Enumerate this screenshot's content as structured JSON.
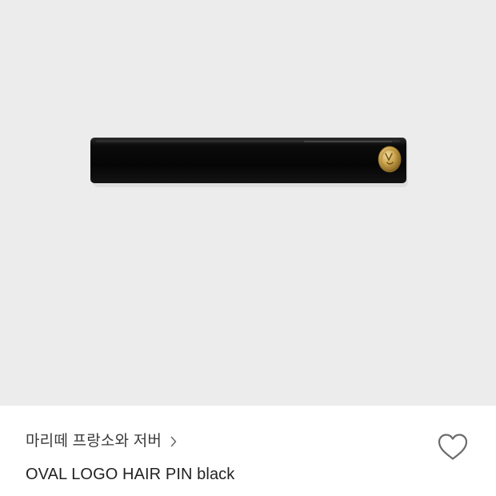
{
  "product": {
    "brand": "마리떼 프랑소와 저버",
    "name": "OVAL LOGO HAIR PIN black"
  },
  "image": {
    "subject": "hair-pin",
    "background_color": "#ececec",
    "pin_color": "#080808",
    "logo_color": "#c9a24a"
  },
  "icons": {
    "brand_chevron": "chevron-right-icon",
    "wishlist": "heart-outline-icon"
  },
  "colors": {
    "text_primary": "#222222",
    "text_secondary": "#3a3a3a",
    "icon_stroke": "#6b6b6b"
  }
}
